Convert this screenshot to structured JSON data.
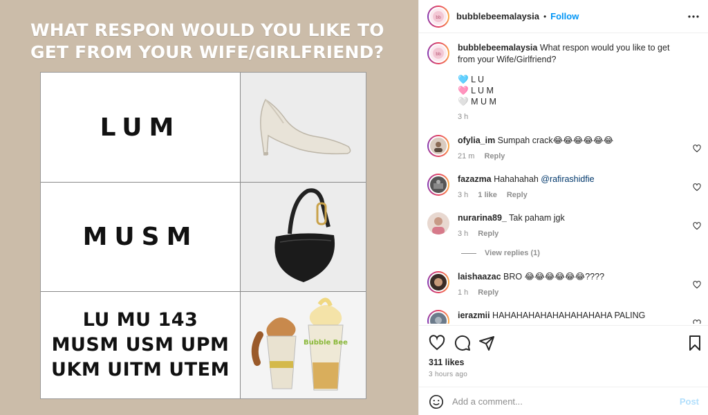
{
  "post": {
    "headline": "WHAT RESPON WOULD YOU LIKE TO GET FROM YOUR WIFE/GIRLFRIEND?",
    "rows": [
      {
        "text": "LUM",
        "image": "white-high-heel-shoe"
      },
      {
        "text": "MUSM",
        "image": "black-handbag"
      },
      {
        "text": "LU MU 143 MUSM USM UPM UKM UITM UTEM",
        "image": "bubblebee-ice-cream-cups"
      }
    ],
    "cup_brand": "Bubble Bee"
  },
  "header": {
    "username": "bubblebeemalaysia",
    "separator": "•",
    "follow_label": "Follow",
    "more_icon": "more-horizontal-icon"
  },
  "caption": {
    "username": "bubblebeemalaysia",
    "text": "What respon would you like to get from your Wife/Girlfriend?",
    "lines": [
      {
        "emoji": "🩵",
        "text": "L U"
      },
      {
        "emoji": "🩷",
        "text": "L U M"
      },
      {
        "emoji": "🤍",
        "text": "M U M"
      }
    ],
    "time": "3 h"
  },
  "comments": [
    {
      "username": "ofylia_im",
      "text": "Sumpah crack😂😂😂😂😂😂",
      "time": "21 m",
      "likes": "",
      "reply": "Reply"
    },
    {
      "username": "fazazma",
      "text": "Hahahahah",
      "mention": "@rafirashidfie",
      "time": "3 h",
      "likes": "1 like",
      "reply": "Reply"
    },
    {
      "username": "nurarina89_",
      "text": "Tak paham jgk",
      "time": "3 h",
      "likes": "",
      "reply": "Reply"
    },
    {
      "username": "laishaazac",
      "text": "BRO 😂😂😂😂😂😂????",
      "time": "1 h",
      "likes": "",
      "reply": "Reply"
    },
    {
      "username": "ierazmii",
      "text": "HAHAHAHAHAHAHAHAHAHA PALING KELAKAR",
      "time": "",
      "likes": "",
      "reply": ""
    }
  ],
  "view_replies": "View replies (1)",
  "actions": {
    "likes": "311 likes",
    "time_ago": "3 hours ago",
    "comment_placeholder": "Add a comment...",
    "post_label": "Post"
  },
  "colors": {
    "follow": "#0095f6",
    "background_left": "#cbbca9",
    "post_disabled": "#b2dffc"
  }
}
